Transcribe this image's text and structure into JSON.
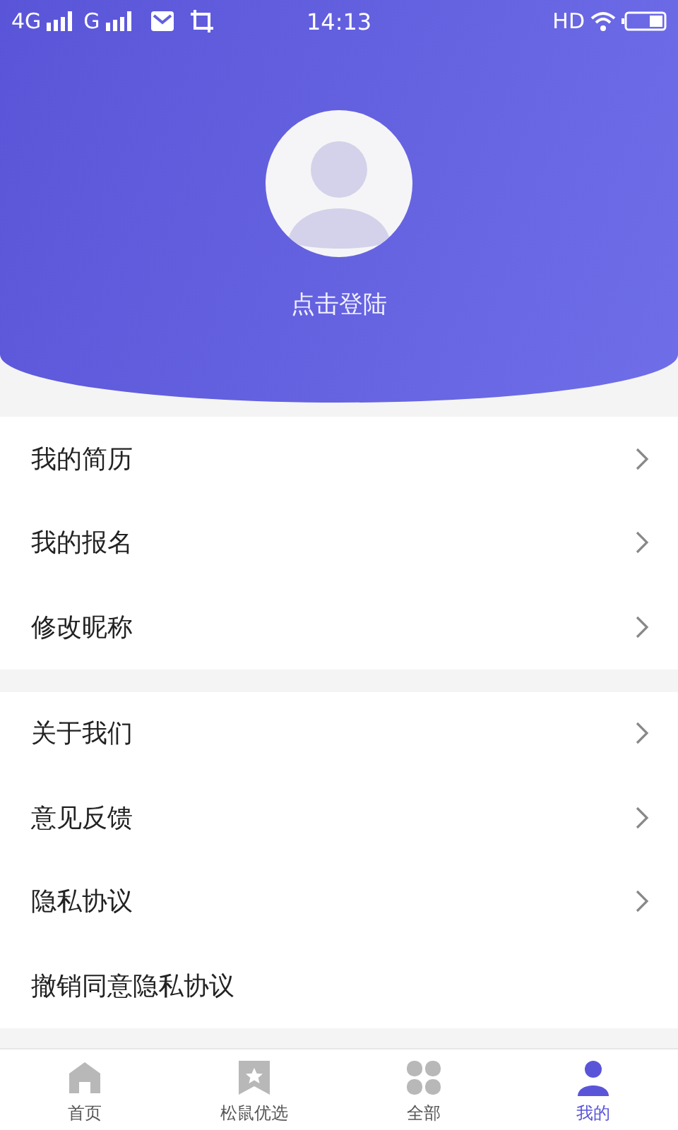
{
  "status_bar": {
    "network_1": "4G",
    "network_2": "G",
    "time": "14:13",
    "hd": "HD"
  },
  "profile": {
    "login_label": "点击登陆"
  },
  "menu_groups": [
    {
      "items": [
        {
          "label": "我的简历",
          "chevron": true
        },
        {
          "label": "我的报名",
          "chevron": true
        },
        {
          "label": "修改昵称",
          "chevron": true
        }
      ]
    },
    {
      "items": [
        {
          "label": "关于我们",
          "chevron": true
        },
        {
          "label": "意见反馈",
          "chevron": true
        },
        {
          "label": "隐私协议",
          "chevron": true
        },
        {
          "label": "撤销同意隐私协议",
          "chevron": false
        }
      ]
    }
  ],
  "tab_bar": [
    {
      "kind": "home",
      "label": "首页",
      "selected": false
    },
    {
      "kind": "bookmark",
      "label": "松鼠优选",
      "selected": false
    },
    {
      "kind": "grid",
      "label": "全部",
      "selected": false
    },
    {
      "kind": "person",
      "label": "我的",
      "selected": true
    }
  ]
}
